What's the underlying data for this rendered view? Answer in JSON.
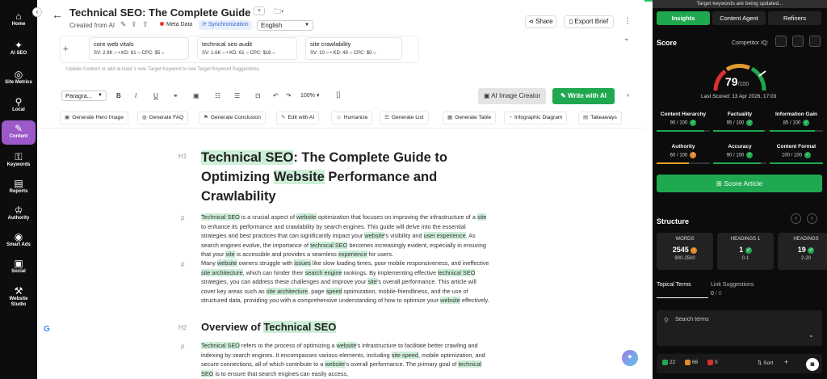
{
  "nav": {
    "collapse_icon": "‹",
    "items": [
      {
        "label": "Home",
        "icon": "⌂"
      },
      {
        "label": "AI SEO",
        "icon": "✦"
      },
      {
        "label": "Site Metrics",
        "icon": "◎"
      },
      {
        "label": "Local",
        "icon": "⚲"
      },
      {
        "label": "Content",
        "icon": "✎"
      },
      {
        "label": "Keywords",
        "icon": "⚿"
      },
      {
        "label": "Reports",
        "icon": "▤"
      },
      {
        "label": "Authority",
        "icon": "♔"
      },
      {
        "label": "Smart Ads",
        "icon": "◉"
      },
      {
        "label": "Social",
        "icon": "▣"
      },
      {
        "label": "Website Studio",
        "icon": "⚒"
      }
    ]
  },
  "header": {
    "title": "Technical SEO: The Complete Guide",
    "created": "Created from AI",
    "meta_data": "Meta Data",
    "sync": "Synchronization",
    "language": "English",
    "share": "Share",
    "export": "Export Brief"
  },
  "keywords": {
    "add_icon": "+",
    "hint": "Update Content or add at least 1 new Target Keyword to see Target Keyword Suggestions.",
    "cards": [
      {
        "name": "core web vitals",
        "stats": "SV: 2.9K ○ • KD: 81 ○ CPC: $5 ○"
      },
      {
        "name": "technical seo audit",
        "stats": "SV: 1.6K ○ • KD: 61 ○ CPC: $16 ○"
      },
      {
        "name": "site crawlability",
        "stats": "SV: 10 ○ • KD: 49 ○ CPC: $0 ○"
      }
    ]
  },
  "toolbar": {
    "style": "Paragra...",
    "zoom": "100%",
    "image_creator": "AI Image Creator",
    "write_ai": "Write with AI"
  },
  "actions": [
    {
      "label": "Generate Hero Image",
      "icon": "▣"
    },
    {
      "label": "Generate FAQ",
      "icon": "◍"
    },
    {
      "label": "Generate Conclusion",
      "icon": "⚑"
    },
    {
      "label": "Edit with AI",
      "icon": "✎"
    },
    {
      "label": "Humanize",
      "icon": "☺"
    },
    {
      "label": "Generate List",
      "icon": "☰"
    },
    {
      "label": "Generate Table",
      "icon": "▦"
    },
    {
      "label": "Infographic Diagram",
      "icon": "◔"
    },
    {
      "label": "Takeaways",
      "icon": "▤"
    }
  ],
  "content": {
    "h1_tag": "H1",
    "p_tag": "p",
    "h2_tag": "H2",
    "h1_parts": [
      "Technical SEO",
      ": The Complete Guide to Optimizing ",
      "Website",
      " Performance and Crawlability"
    ],
    "p1": [
      [
        "h",
        "Technical SEO"
      ],
      [
        "t",
        " is a crucial aspect of "
      ],
      [
        "h",
        "website"
      ],
      [
        "t",
        " optimization that focuses on improving the infrastructure of a "
      ],
      [
        "h",
        "site"
      ],
      [
        "t",
        " to enhance its performance and crawlability by search engines. This guide will delve into the essential strategies and best practices that can significantly impact your "
      ],
      [
        "h",
        "website"
      ],
      [
        "t",
        "'s visibility and "
      ],
      [
        "h",
        "user experience"
      ],
      [
        "t",
        ". As search engines evolve, the importance of "
      ],
      [
        "h",
        "technical SEO"
      ],
      [
        "t",
        " becomes increasingly evident, especially in ensuring that your "
      ],
      [
        "h",
        "site"
      ],
      [
        "t",
        " is accessible and provides a seamless "
      ],
      [
        "h",
        "experience"
      ],
      [
        "t",
        " for users."
      ]
    ],
    "p2": [
      [
        "t",
        "Many "
      ],
      [
        "h",
        "website"
      ],
      [
        "t",
        " owners struggle with "
      ],
      [
        "h",
        "issues"
      ],
      [
        "t",
        " like slow loading times, poor mobile responsiveness, and ineffective "
      ],
      [
        "h",
        "site architecture"
      ],
      [
        "t",
        ", which can hinder their "
      ],
      [
        "h",
        "search engine"
      ],
      [
        "t",
        " rankings. By implementing effective "
      ],
      [
        "h",
        "technical SEO"
      ],
      [
        "t",
        " strategies, you can address these challenges and improve your "
      ],
      [
        "h",
        "site"
      ],
      [
        "t",
        "'s overall performance. This article will cover key areas such as "
      ],
      [
        "h",
        "site architecture"
      ],
      [
        "t",
        ", page "
      ],
      [
        "h",
        "speed"
      ],
      [
        "t",
        " optimization, mobile-friendliness, and the use of structured data, providing you with a comprehensive understanding of how to optimize your "
      ],
      [
        "h",
        "website"
      ],
      [
        "t",
        " effectively."
      ]
    ],
    "h2_parts": [
      "Overview of ",
      "Technical SEO"
    ],
    "p3": [
      [
        "h",
        "Technical SEO"
      ],
      [
        "t",
        " refers to the process of optimizing a "
      ],
      [
        "h",
        "website"
      ],
      [
        "t",
        "'s infrastructure to facilitate better crawling and indexing by search engines. It encompasses various elements, including "
      ],
      [
        "h",
        "site speed"
      ],
      [
        "t",
        ", mobile optimization, and secure connections, all of which contribute to a "
      ],
      [
        "h",
        "website"
      ],
      [
        "t",
        "'s overall performance. The primary goal of "
      ],
      [
        "h",
        "technical SEO"
      ],
      [
        "t",
        " is to ensure that search engines can easily access,"
      ]
    ]
  },
  "panel": {
    "banner": "Target keywords are being updated...",
    "tabs": [
      "Insights",
      "Content Agent",
      "Refiners"
    ],
    "score_label": "Score",
    "competitor_label": "Competitor IQ:",
    "score": 79,
    "score_max": "/100",
    "last_scored": "Last Scored: 13 Apr 2026, 17:03",
    "metrics": [
      {
        "name": "Content Hierarchy",
        "value": "90 / 100",
        "pct": 0.9,
        "color": "#1fa84f"
      },
      {
        "name": "Factuality",
        "value": "95 / 100",
        "pct": 0.95,
        "color": "#1fa84f"
      },
      {
        "name": "Information Gain",
        "value": "85 / 100",
        "pct": 0.85,
        "color": "#1fa84f"
      },
      {
        "name": "Authority",
        "value": "60 / 100",
        "pct": 0.6,
        "color": "#e0a020"
      },
      {
        "name": "Accuracy",
        "value": "90 / 100",
        "pct": 0.9,
        "color": "#1fa84f"
      },
      {
        "name": "Content Format",
        "value": "100 / 100",
        "pct": 1.0,
        "color": "#1fa84f"
      }
    ],
    "score_button": "Score Article",
    "structure_label": "Structure",
    "structure": [
      {
        "label": "WORDS",
        "value": "2545",
        "range": "900-2500",
        "status": "up"
      },
      {
        "label": "HEADINGS 1",
        "value": "1",
        "range": "0-1",
        "status": "ok"
      },
      {
        "label": "HEADINGS",
        "value": "19",
        "range": "2-20",
        "status": "ok"
      }
    ],
    "topical_terms": "Topical Terms",
    "link_suggestions": "Link Suggestions",
    "link_count": "0",
    "link_count_suffix": "/ 0",
    "search_placeholder": "Search terms",
    "counts": [
      "22",
      "66",
      "0"
    ],
    "sort": "Sort"
  }
}
